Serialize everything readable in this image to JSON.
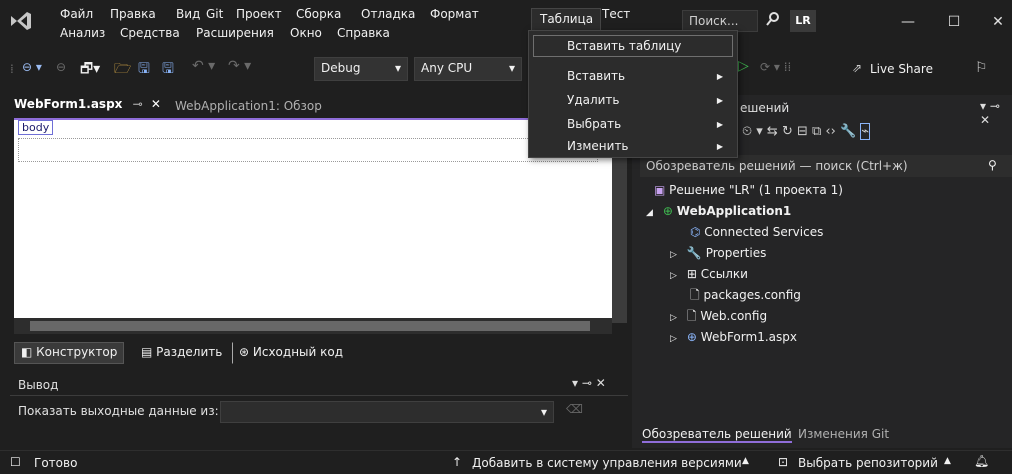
{
  "menu": {
    "file": "Файл",
    "edit": "Правка",
    "view": "Вид",
    "git": "Git",
    "project": "Проект",
    "build": "Сборка",
    "debug": "Отладка",
    "format": "Формат",
    "table": "Таблица",
    "test": "Тест",
    "analyze": "Анализ",
    "tools": "Средства",
    "extensions": "Расширения",
    "window": "Окно",
    "help": "Справка"
  },
  "search": {
    "placeholder": "Поиск..."
  },
  "user": {
    "initials": "LR"
  },
  "toolbar": {
    "config": "Debug",
    "platform": "Any CPU",
    "live_share": "Live Share"
  },
  "doc_tabs": {
    "active": "WebForm1.aspx",
    "inactive": "WebApplication1: Обзор"
  },
  "editor": {
    "body_tag": "body"
  },
  "view_switch": {
    "designer": "Конструктор",
    "split": "Разделить",
    "source": "Исходный код"
  },
  "output": {
    "title": "Вывод",
    "show_from": "Показать выходные данные из:"
  },
  "context_menu": {
    "header": "Таблица",
    "items": [
      {
        "label": "Вставить таблицу",
        "has_sub": false
      },
      {
        "label": "Вставить",
        "has_sub": true
      },
      {
        "label": "Удалить",
        "has_sub": true
      },
      {
        "label": "Выбрать",
        "has_sub": true
      },
      {
        "label": "Изменить",
        "has_sub": true
      }
    ]
  },
  "solution_explorer": {
    "title_partial": "ешений",
    "search": "Обозреватель решений — поиск (Ctrl+ж)",
    "tree": [
      {
        "label": "Решение \"LR\" (1 проекта 1)",
        "bold": false,
        "expander": ""
      },
      {
        "label": "WebApplication1",
        "bold": true,
        "expander": "◢"
      },
      {
        "label": "Connected Services",
        "bold": false,
        "expander": ""
      },
      {
        "label": "Properties",
        "bold": false,
        "expander": "▷"
      },
      {
        "label": "Ссылки",
        "bold": false,
        "expander": "▷"
      },
      {
        "label": "packages.config",
        "bold": false,
        "expander": ""
      },
      {
        "label": "Web.config",
        "bold": false,
        "expander": "▷"
      },
      {
        "label": "WebForm1.aspx",
        "bold": false,
        "expander": "▷"
      }
    ],
    "footer_tabs": [
      "Обозреватель решений",
      "Изменения Git"
    ]
  },
  "status": {
    "ready": "Готово",
    "add_to_vcs": "Добавить в систему управления версиями",
    "select_repo": "Выбрать репозиторий"
  },
  "colors": {
    "accent": "#8f6dd9",
    "bg": "#1f1f1f",
    "panel": "#252526",
    "menu_bg": "#2c2c2c"
  }
}
